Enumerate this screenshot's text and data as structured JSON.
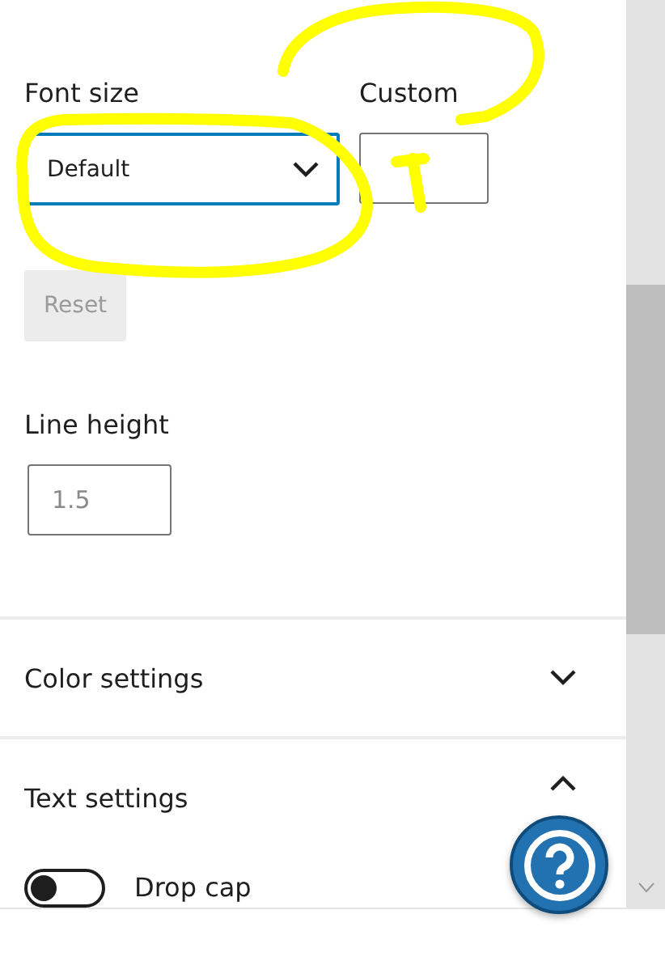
{
  "font_size": {
    "label": "Font size",
    "select": {
      "value": "Default"
    },
    "custom": {
      "label": "Custom"
    },
    "reset": {
      "label": "Reset",
      "disabled": true
    }
  },
  "line_height": {
    "label": "Line height",
    "placeholder": "1.5"
  },
  "panels": [
    {
      "title": "Color settings",
      "expanded": false
    },
    {
      "title": "Text settings",
      "expanded": true,
      "toggles": [
        {
          "label": "Drop cap",
          "on": false
        }
      ]
    }
  ]
}
